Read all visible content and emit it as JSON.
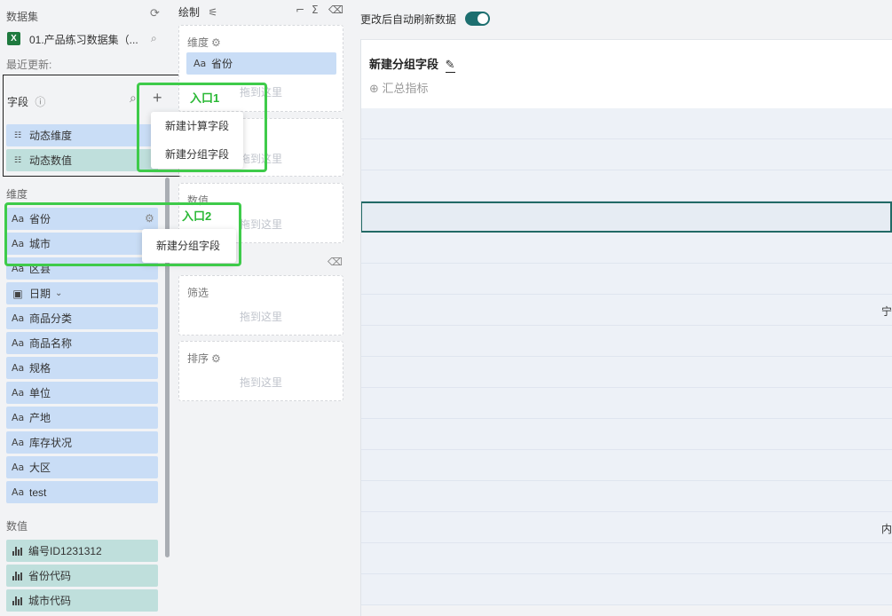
{
  "dataset": {
    "header": "数据集",
    "file_name": "01.产品练习数据集（...",
    "last_update": "最近更新:"
  },
  "fields": {
    "header": "字段",
    "dynamic_items": [
      {
        "label": "动态维度",
        "icon": "dynamic-icon"
      },
      {
        "label": "动态数值",
        "icon": "dynamic-icon"
      }
    ]
  },
  "add_menu": {
    "items": [
      "新建计算字段",
      "新建分组字段"
    ]
  },
  "entry_labels": {
    "entry1": "入口1",
    "entry2": "入口2"
  },
  "dimensions": {
    "header": "维度",
    "items": [
      {
        "label": "省份",
        "icon": "Aa"
      },
      {
        "label": "城市",
        "icon": "Aa"
      },
      {
        "label": "区县",
        "icon": "Aa"
      },
      {
        "label": "日期",
        "icon": "calendar-icon"
      },
      {
        "label": "商品分类",
        "icon": "Aa"
      },
      {
        "label": "商品名称",
        "icon": "Aa"
      },
      {
        "label": "规格",
        "icon": "Aa"
      },
      {
        "label": "单位",
        "icon": "Aa"
      },
      {
        "label": "产地",
        "icon": "Aa"
      },
      {
        "label": "库存状况",
        "icon": "Aa"
      },
      {
        "label": "大区",
        "icon": "Aa"
      },
      {
        "label": "test",
        "icon": "Aa"
      }
    ]
  },
  "dim_context_menu": {
    "items": [
      "新建分组字段"
    ]
  },
  "measures": {
    "header": "数值",
    "items": [
      {
        "label": "编号ID1231312",
        "icon": "bar-chart-icon"
      },
      {
        "label": "省份代码",
        "icon": "bar-chart-icon"
      },
      {
        "label": "城市代码",
        "icon": "bar-chart-icon"
      }
    ]
  },
  "draw": {
    "title": "绘制",
    "dimension_zone": {
      "title": "维度",
      "field": "省份",
      "hint": "拖到这里"
    },
    "zone2_hint": "拖到这里",
    "value_zone": {
      "title": "数值",
      "hint": "拖到这里"
    },
    "filter_zone": {
      "title": "筛选",
      "hint": "拖到这里"
    },
    "sort_zone": {
      "title": "排序",
      "hint": "拖到这里"
    }
  },
  "auto_refresh": {
    "label": "更改后自动刷新数据",
    "on": true
  },
  "preview": {
    "title": "新建分组字段",
    "summary": "汇总指标",
    "row_texts": [
      {
        "row": 6,
        "text": "宁"
      },
      {
        "row": 13,
        "text": "内"
      }
    ]
  },
  "colors": {
    "accent": "#1d6f70",
    "dimension_pill": "#c9ddf6",
    "measure_pill": "#bfdfdc",
    "highlight": "#3ecb4a"
  }
}
